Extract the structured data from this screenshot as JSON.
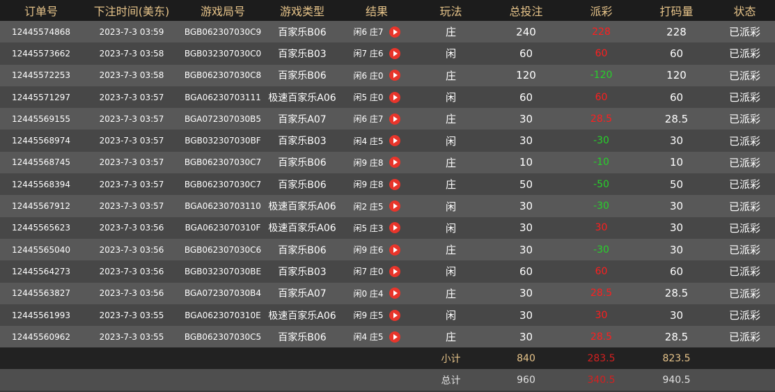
{
  "headers": [
    "订单号",
    "下注时间(美东)",
    "游戏局号",
    "游戏类型",
    "结果",
    "玩法",
    "总投注",
    "派彩",
    "打码量",
    "状态"
  ],
  "rows": [
    {
      "order": "12445574868",
      "time": "2023-7-3 03:59",
      "round": "BGB062307030C9",
      "game": "百家乐B06",
      "result": "闲6 庄7",
      "play": "庄",
      "bet": "240",
      "payout": "228",
      "payout_color": "neg",
      "code": "228",
      "status": "已派彩"
    },
    {
      "order": "12445573662",
      "time": "2023-7-3 03:58",
      "round": "BGB032307030C0",
      "game": "百家乐B03",
      "result": "闲7 庄6",
      "play": "闲",
      "bet": "60",
      "payout": "60",
      "payout_color": "neg",
      "code": "60",
      "status": "已派彩"
    },
    {
      "order": "12445572253",
      "time": "2023-7-3 03:58",
      "round": "BGB062307030C8",
      "game": "百家乐B06",
      "result": "闲6 庄0",
      "play": "庄",
      "bet": "120",
      "payout": "-120",
      "payout_color": "pos",
      "code": "120",
      "status": "已派彩"
    },
    {
      "order": "12445571297",
      "time": "2023-7-3 03:57",
      "round": "BGA06230703111",
      "game": "极速百家乐A06",
      "result": "闲5 庄0",
      "play": "闲",
      "bet": "60",
      "payout": "60",
      "payout_color": "neg",
      "code": "60",
      "status": "已派彩"
    },
    {
      "order": "12445569155",
      "time": "2023-7-3 03:57",
      "round": "BGA072307030B5",
      "game": "百家乐A07",
      "result": "闲6 庄7",
      "play": "庄",
      "bet": "30",
      "payout": "28.5",
      "payout_color": "neg",
      "code": "28.5",
      "status": "已派彩"
    },
    {
      "order": "12445568974",
      "time": "2023-7-3 03:57",
      "round": "BGB032307030BF",
      "game": "百家乐B03",
      "result": "闲4 庄5",
      "play": "闲",
      "bet": "30",
      "payout": "-30",
      "payout_color": "pos",
      "code": "30",
      "status": "已派彩"
    },
    {
      "order": "12445568745",
      "time": "2023-7-3 03:57",
      "round": "BGB062307030C7",
      "game": "百家乐B06",
      "result": "闲9 庄8",
      "play": "庄",
      "bet": "10",
      "payout": "-10",
      "payout_color": "pos",
      "code": "10",
      "status": "已派彩"
    },
    {
      "order": "12445568394",
      "time": "2023-7-3 03:57",
      "round": "BGB062307030C7",
      "game": "百家乐B06",
      "result": "闲9 庄8",
      "play": "庄",
      "bet": "50",
      "payout": "-50",
      "payout_color": "pos",
      "code": "50",
      "status": "已派彩"
    },
    {
      "order": "12445567912",
      "time": "2023-7-3 03:57",
      "round": "BGA06230703110",
      "game": "极速百家乐A06",
      "result": "闲2 庄5",
      "play": "闲",
      "bet": "30",
      "payout": "-30",
      "payout_color": "pos",
      "code": "30",
      "status": "已派彩"
    },
    {
      "order": "12445565623",
      "time": "2023-7-3 03:56",
      "round": "BGA0623070310F",
      "game": "极速百家乐A06",
      "result": "闲5 庄3",
      "play": "闲",
      "bet": "30",
      "payout": "30",
      "payout_color": "neg",
      "code": "30",
      "status": "已派彩"
    },
    {
      "order": "12445565040",
      "time": "2023-7-3 03:56",
      "round": "BGB062307030C6",
      "game": "百家乐B06",
      "result": "闲9 庄6",
      "play": "庄",
      "bet": "30",
      "payout": "-30",
      "payout_color": "pos",
      "code": "30",
      "status": "已派彩"
    },
    {
      "order": "12445564273",
      "time": "2023-7-3 03:56",
      "round": "BGB032307030BE",
      "game": "百家乐B03",
      "result": "闲7 庄0",
      "play": "闲",
      "bet": "60",
      "payout": "60",
      "payout_color": "neg",
      "code": "60",
      "status": "已派彩"
    },
    {
      "order": "12445563827",
      "time": "2023-7-3 03:56",
      "round": "BGA072307030B4",
      "game": "百家乐A07",
      "result": "闲0 庄4",
      "play": "庄",
      "bet": "30",
      "payout": "28.5",
      "payout_color": "neg",
      "code": "28.5",
      "status": "已派彩"
    },
    {
      "order": "12445561993",
      "time": "2023-7-3 03:55",
      "round": "BGA0623070310E",
      "game": "极速百家乐A06",
      "result": "闲9 庄5",
      "play": "闲",
      "bet": "30",
      "payout": "30",
      "payout_color": "neg",
      "code": "30",
      "status": "已派彩"
    },
    {
      "order": "12445560962",
      "time": "2023-7-3 03:55",
      "round": "BGB062307030C5",
      "game": "百家乐B06",
      "result": "闲4 庄5",
      "play": "庄",
      "bet": "30",
      "payout": "28.5",
      "payout_color": "neg",
      "code": "28.5",
      "status": "已派彩"
    }
  ],
  "subtotal": {
    "label": "小计",
    "bet": "840",
    "payout": "283.5",
    "code": "823.5"
  },
  "total": {
    "label": "总计",
    "bet": "960",
    "payout": "340.5",
    "code": "940.5"
  },
  "icons": {
    "result_play": "play-icon"
  },
  "colors": {
    "header_text": "#e7c48a",
    "payout_negative": "#ff1e1e",
    "payout_positive": "#27d12a",
    "play_button": "#e8352b"
  }
}
